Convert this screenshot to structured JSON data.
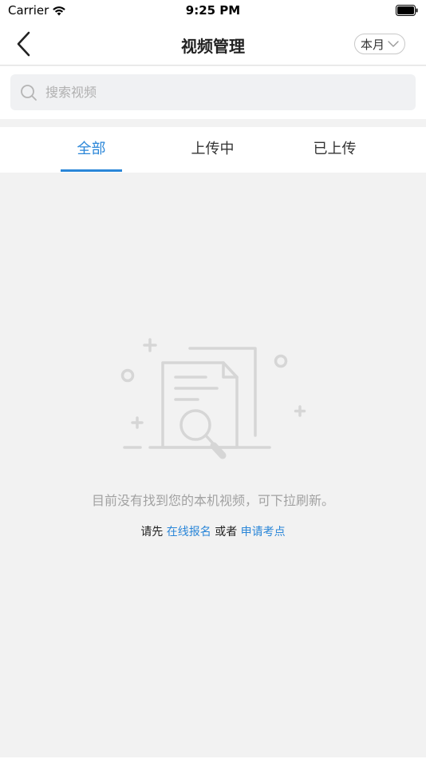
{
  "status_bar": {
    "carrier": "Carrier",
    "time": "9:25 PM"
  },
  "nav": {
    "title": "视频管理",
    "month_label": "本月"
  },
  "search": {
    "placeholder": "搜索视频",
    "value": ""
  },
  "tabs": [
    {
      "label": "全部",
      "active": true
    },
    {
      "label": "上传中",
      "active": false
    },
    {
      "label": "已上传",
      "active": false
    }
  ],
  "empty": {
    "message": "目前没有找到您的本机视频，可下拉刷新。",
    "hint_prefix": "请先",
    "link_register": "在线报名",
    "hint_or": "或者",
    "link_apply": "申请考点"
  },
  "colors": {
    "accent": "#2a86d8",
    "background": "#f2f2f2",
    "illustration": "#d6d6d6"
  }
}
